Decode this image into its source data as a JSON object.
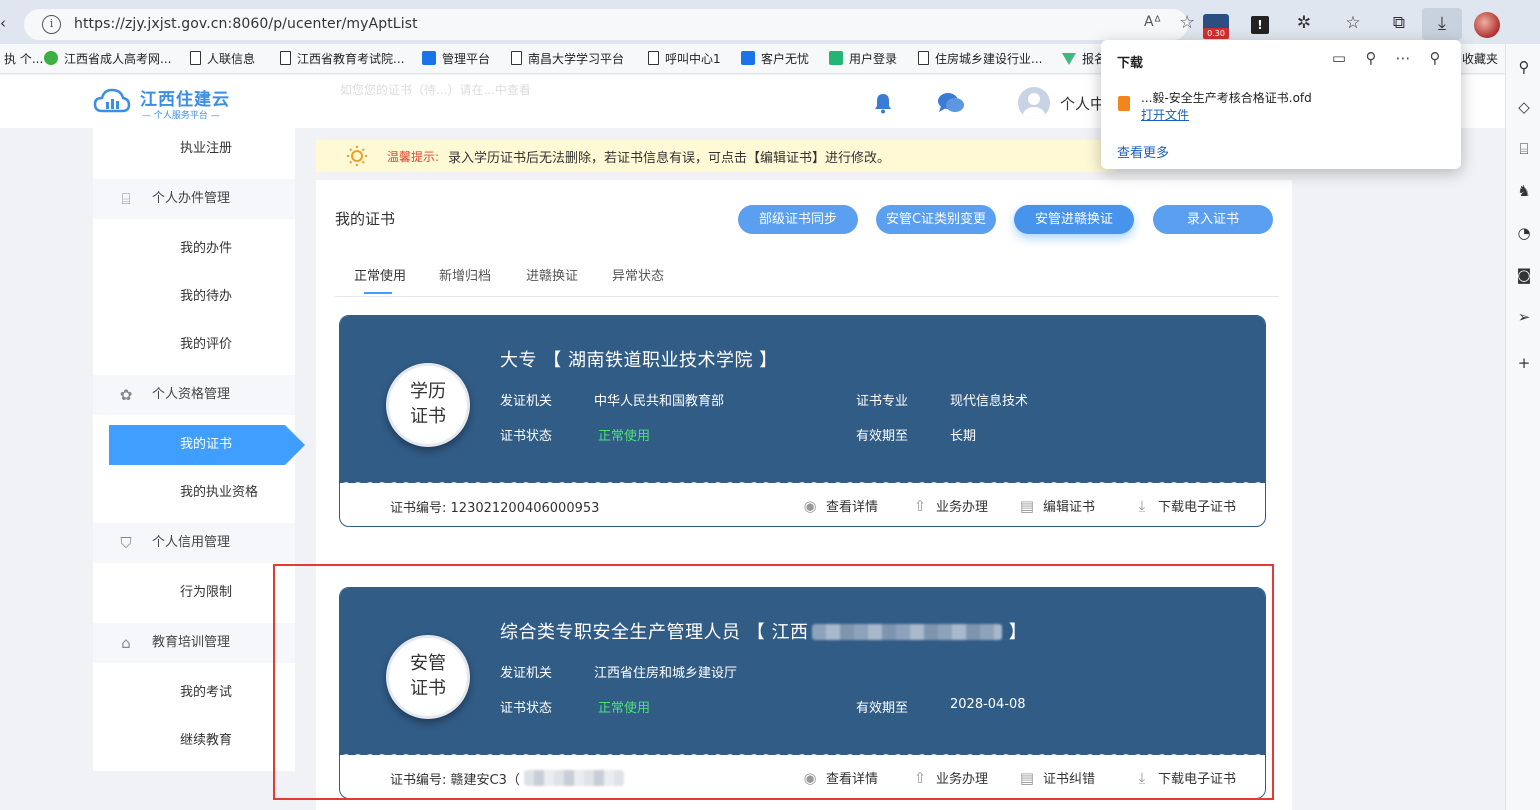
{
  "browser": {
    "back_glyph": "‹",
    "url": "https://zjy.jxjst.gov.cn:8060/p/ucenter/myAptList",
    "read_aloud": "A̅",
    "ext_badge": "0.30",
    "ext_letter": "!"
  },
  "bookmarks": [
    {
      "label": "执 个...",
      "icon": "none"
    },
    {
      "label": "江西省成人高考网...",
      "icon": "green"
    },
    {
      "label": "人联信息",
      "icon": "page"
    },
    {
      "label": "江西省教育考试院...",
      "icon": "page"
    },
    {
      "label": "管理平台",
      "icon": "blue"
    },
    {
      "label": "南昌大学学习平台",
      "icon": "page"
    },
    {
      "label": "呼叫中心1",
      "icon": "page"
    },
    {
      "label": "客户无忧",
      "icon": "blue"
    },
    {
      "label": "用户登录",
      "icon": "teal"
    },
    {
      "label": "住房城乡建设行业...",
      "icon": "page"
    },
    {
      "label": "报名",
      "icon": "vue"
    },
    {
      "label": "收藏夹",
      "icon": "none"
    }
  ],
  "download_popup": {
    "title": "下载",
    "file_name": "...毅-安全生产考核合格证书.ofd",
    "open_file": "打开文件",
    "see_more": "查看更多"
  },
  "site": {
    "logo_title": "江西住建云",
    "logo_subtitle": "— 个人服务平台 —",
    "header_ghost": "如您您的证书（待...）请在...中查看",
    "user_label": "个人中"
  },
  "menu": [
    {
      "label": "执业注册",
      "type": "sub"
    },
    {
      "label": "个人办件管理",
      "type": "group",
      "icon": "briefcase-icon"
    },
    {
      "label": "我的办件",
      "type": "sub"
    },
    {
      "label": "我的待办",
      "type": "sub"
    },
    {
      "label": "我的评价",
      "type": "sub"
    },
    {
      "label": "个人资格管理",
      "type": "group",
      "icon": "award-icon"
    },
    {
      "label": "我的证书",
      "type": "active"
    },
    {
      "label": "我的执业资格",
      "type": "sub"
    },
    {
      "label": "个人信用管理",
      "type": "group",
      "icon": "shield-icon"
    },
    {
      "label": "行为限制",
      "type": "sub"
    },
    {
      "label": "教育培训管理",
      "type": "group",
      "icon": "graduation-cap-icon"
    },
    {
      "label": "我的考试",
      "type": "sub"
    },
    {
      "label": "继续教育",
      "type": "sub"
    }
  ],
  "notice": {
    "label": "温馨提示:",
    "text": "录入学历证书后无法删除，若证书信息有误，可点击【编辑证书】进行修改。"
  },
  "main": {
    "title": "我的证书",
    "buttons": [
      "部级证书同步",
      "安管C证类别变更",
      "安管进赣换证",
      "录入证书"
    ],
    "tabs": [
      "正常使用",
      "新增归档",
      "进赣换证",
      "异常状态"
    ]
  },
  "cards": [
    {
      "badge": "学历\n证书",
      "title": "大专 【 湖南铁道职业技术学院 】",
      "issuer_label": "发证机关",
      "issuer": "中华人民共和国教育部",
      "major_label": "证书专业",
      "major": "现代信息技术",
      "status_label": "证书状态",
      "status": "正常使用",
      "valid_label": "有效期至",
      "valid": "长期",
      "number_label": "证书编号:",
      "number": "123021200406000953",
      "actions": [
        "查看详情",
        "业务办理",
        "编辑证书",
        "下载电子证书"
      ]
    },
    {
      "badge": "安管\n证书",
      "title": "综合类专职安全生产管理人员 【 江西",
      "issuer_label": "发证机关",
      "issuer": "江西省住房和城乡建设厅",
      "status_label": "证书状态",
      "status": "正常使用",
      "valid_label": "有效期至",
      "valid": "2028-04-08",
      "number_label": "证书编号:",
      "number": "赣建安C3（",
      "actions": [
        "查看详情",
        "业务办理",
        "证书纠错",
        "下载电子证书"
      ]
    }
  ],
  "colors": {
    "primary": "#409eff",
    "card_bg": "#315c86",
    "status_ok": "#4fe07a",
    "highlight_box": "#e53935"
  }
}
